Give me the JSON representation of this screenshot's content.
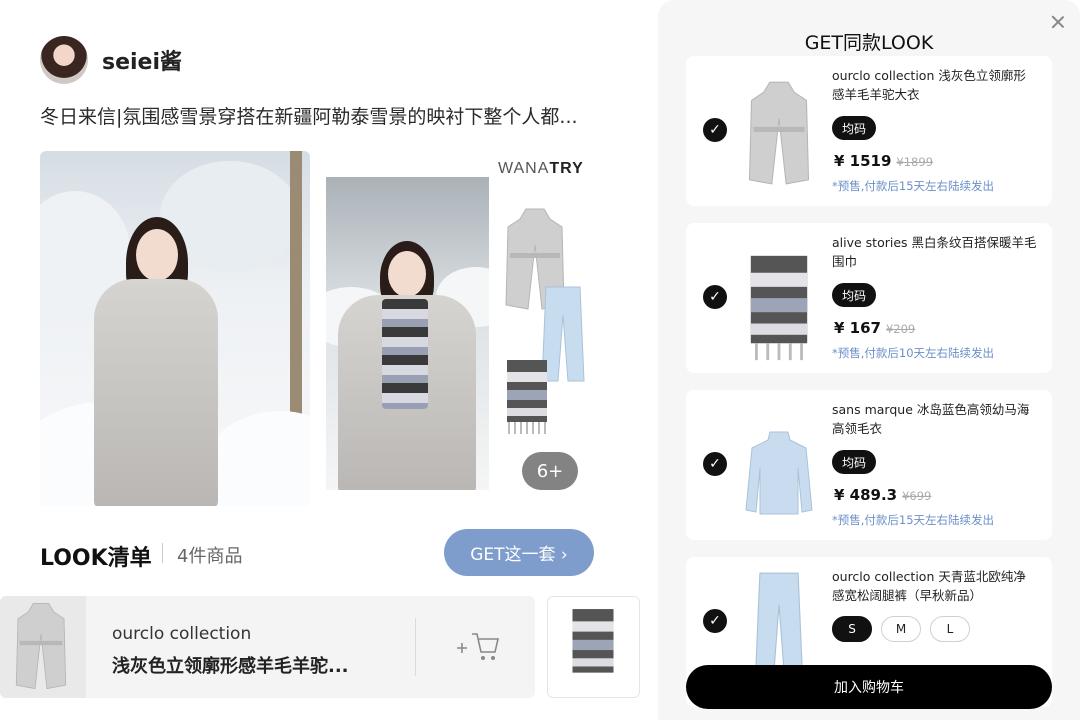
{
  "post": {
    "username": "seiei酱",
    "text": "冬日来信|氛围感雪景穿搭在新疆阿勒泰雪景的映衬下整个人都...",
    "brand_logo_a": "WANA",
    "brand_logo_b": "TRY",
    "more_count": "6+"
  },
  "look": {
    "title": "LOOK清单",
    "count": "4件商品",
    "get_set_label": "GET这一套 ›"
  },
  "card": {
    "brand": "ourclo collection",
    "name": "浅灰色立领廓形感羊毛羊驼..."
  },
  "sheet": {
    "title": "GET同款LOOK",
    "add_to_cart": "加入购物车",
    "items": [
      {
        "name": "ourclo collection 浅灰色立领廓形感羊毛羊驼大衣",
        "size": "均码",
        "price": "¥ 1519",
        "orig_price": "¥1899",
        "note": "*预售,付款后15天左右陆续发出"
      },
      {
        "name": "alive stories 黑白条纹百搭保暖羊毛围巾",
        "size": "均码",
        "price": "¥ 167",
        "orig_price": "¥209",
        "note": "*预售,付款后10天左右陆续发出"
      },
      {
        "name": "sans marque 冰岛蓝色高领幼马海高领毛衣",
        "size": "均码",
        "price": "¥ 489.3",
        "orig_price": "¥699",
        "note": "*预售,付款后15天左右陆续发出"
      },
      {
        "name": "ourclo collection 天青蓝北欧纯净感宽松阔腿裤（早秋新品）",
        "sizes": [
          "S",
          "M",
          "L"
        ],
        "selected_size": "S"
      }
    ]
  },
  "colors": {
    "accent_button": "#7e9ccc",
    "note_text": "#6a8fc9",
    "check": "#111111"
  }
}
